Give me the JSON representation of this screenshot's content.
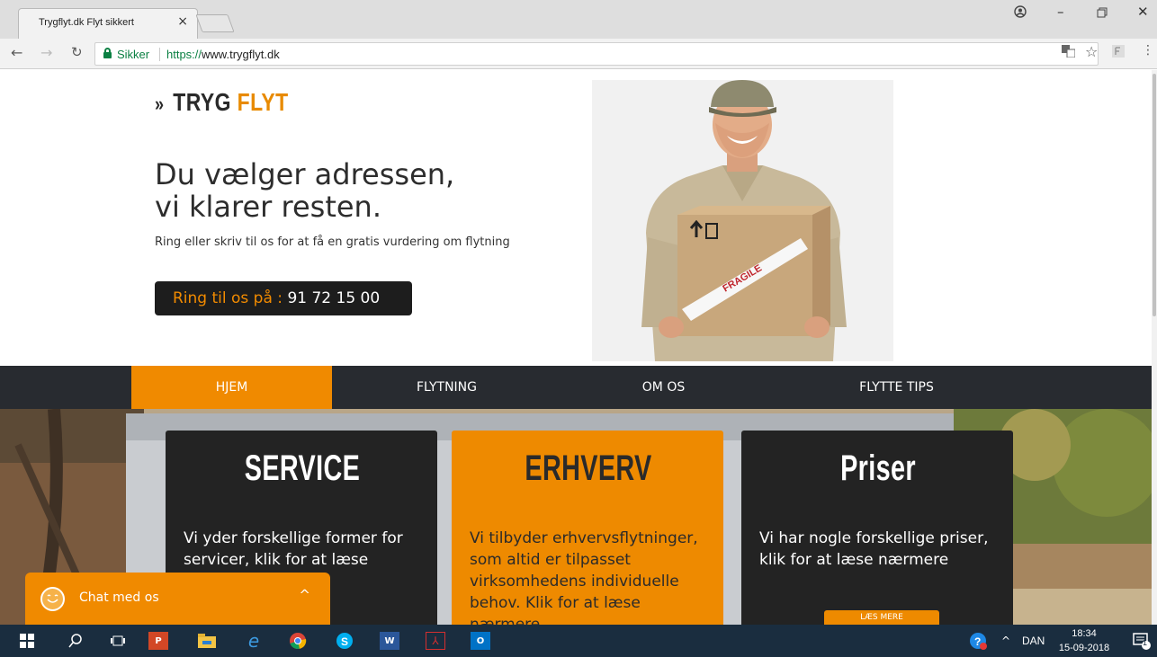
{
  "browser": {
    "tab_title": "Trygflyt.dk Flyt sikkert",
    "tab_close": "×",
    "secure_label": "Sikker",
    "url_scheme": "https://",
    "url_host": "www.trygflyt.dk"
  },
  "site": {
    "logo_chevron": "»",
    "logo_word1": "TRYG",
    "logo_word2": "FLYT",
    "hero_line1": "Du vælger adressen,",
    "hero_line2": "vi klarer resten.",
    "hero_sub": "Ring eller skriv til os for at få en gratis vurdering om flytning",
    "call_label": "Ring til os på : ",
    "call_number": "91 72 15 00",
    "box_label": "FRAGILE"
  },
  "nav": {
    "items": [
      "HJEM",
      "FLYTNING",
      "OM OS",
      "FLYTTE TIPS"
    ],
    "active": 0
  },
  "cards": [
    {
      "title": "SERVICE",
      "text": "Vi yder forskellige former for servicer, klik for at læse nærmere"
    },
    {
      "title": "ERHVERV",
      "text": "Vi tilbyder erhvervsflytninger, som altid er tilpasset virksomhedens individuelle behov. Klik for at læse nærmere"
    },
    {
      "title": "Priser",
      "text": "Vi har nogle forskellige priser, klik for at læse nærmere",
      "button": "LÆS MERE"
    }
  ],
  "chat": {
    "label": "Chat med os",
    "caret": "^"
  },
  "taskbar": {
    "lang": "DAN",
    "time": "18:34",
    "date": "15-09-2018",
    "notif_count": "1"
  },
  "colors": {
    "accent": "#f08a00",
    "dark": "#232323",
    "nav_bg": "#282b30"
  }
}
